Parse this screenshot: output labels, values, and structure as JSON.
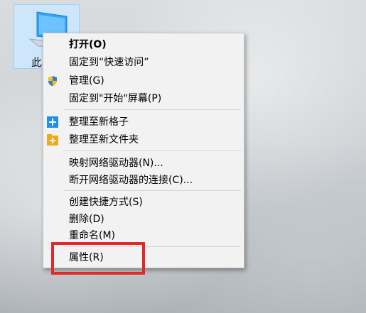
{
  "desktop": {
    "icon_label": "此电脑"
  },
  "context_menu": {
    "items": [
      {
        "label": "打开(O)",
        "icon": null
      },
      {
        "label": "固定到“快速访问”",
        "icon": null
      },
      {
        "label": "管理(G)",
        "icon": "shield-icon"
      },
      {
        "label": "固定到\"开始\"屏幕(P)",
        "icon": null
      },
      {
        "label": "整理至新格子",
        "icon": "plus-blue-icon"
      },
      {
        "label": "整理至新文件夹",
        "icon": "plus-folder-icon"
      },
      {
        "label": "映射网络驱动器(N)...",
        "icon": null
      },
      {
        "label": "断开网络驱动器的连接(C)...",
        "icon": null
      },
      {
        "label": "创建快捷方式(S)",
        "icon": null
      },
      {
        "label": "删除(D)",
        "icon": null
      },
      {
        "label": "重命名(M)",
        "icon": null
      },
      {
        "label": "属性(R)",
        "icon": null
      }
    ]
  },
  "colors": {
    "highlight_border": "#e0292b",
    "plus_blue": "#1e90e8",
    "plus_folder": "#f2a91f"
  }
}
